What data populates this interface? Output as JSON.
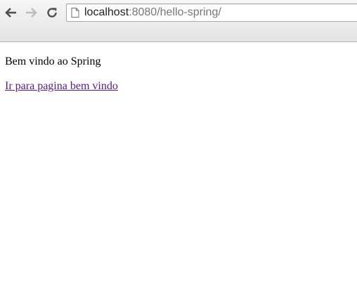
{
  "browser": {
    "toolbar": {
      "back_icon": "arrow-left-icon",
      "forward_icon": "arrow-right-icon",
      "reload_icon": "reload-icon"
    },
    "address_bar": {
      "icon": "page-icon",
      "host": "localhost",
      "rest": ":8080/hello-spring/"
    }
  },
  "page": {
    "welcome_text": "Bem vindo ao Spring",
    "link_text": "Ir para pagina bem vindo"
  },
  "colors": {
    "visited_link": "#551a8b",
    "toolbar_bg": "#e3e3e3"
  }
}
